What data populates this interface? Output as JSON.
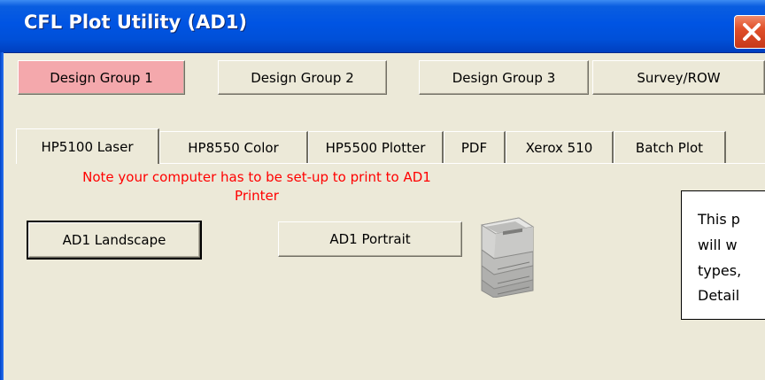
{
  "window": {
    "title": "CFL Plot Utility (AD1)",
    "close_icon": "close-icon",
    "close_color": "#e0502a"
  },
  "design_groups": [
    {
      "label": "Design Group 1",
      "active": true
    },
    {
      "label": "Design Group 2",
      "active": false
    },
    {
      "label": "Design Group 3",
      "active": false
    },
    {
      "label": "Survey/ROW",
      "active": false
    }
  ],
  "tabs": [
    {
      "label": "HP5100 Laser",
      "active": true
    },
    {
      "label": "HP8550 Color",
      "active": false
    },
    {
      "label": "HP5500 Plotter",
      "active": false
    },
    {
      "label": "PDF",
      "active": false
    },
    {
      "label": "Xerox 510",
      "active": false
    },
    {
      "label": "Batch Plot",
      "active": false
    }
  ],
  "note": {
    "line1": "Note your computer has to be set-up to print to AD1",
    "line2": "Printer",
    "color": "#ff0000"
  },
  "buttons": {
    "landscape": "AD1 Landscape",
    "portrait": "AD1 Portrait"
  },
  "printer_icon": "printer-icon",
  "info_box": {
    "lines": [
      "This p",
      "will w",
      "types,",
      "Detail"
    ]
  },
  "colors": {
    "title_bar": "#0054e3",
    "window_bg": "#ece9d8",
    "active_group": "#f4a8ac"
  }
}
